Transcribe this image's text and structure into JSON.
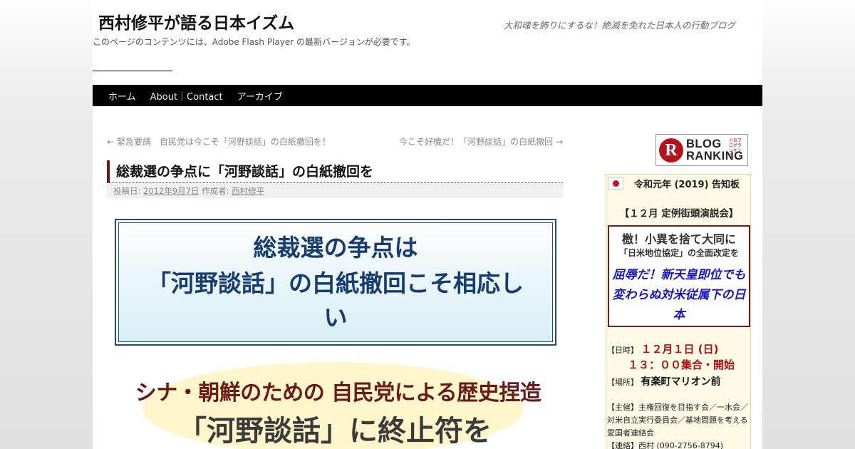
{
  "header": {
    "site_title": "西村修平が語る日本イズム",
    "tagline": "大和魂を飾りにするな！絶滅を免れた日本人の行動ブログ",
    "flash_notice": "このページのコンテンツには、Adobe Flash Player の最新バージョンが必要です。"
  },
  "nav": {
    "items": [
      {
        "label": "ホーム"
      },
      {
        "label": "About｜Contact"
      },
      {
        "label": "アーカイブ"
      }
    ]
  },
  "post_nav": {
    "prev": "← 緊急要請　自民党は今こそ「河野談話」の白紙撤回を！",
    "next": "今こそ好機だ！「河野談話」の白紙撤回 →"
  },
  "post": {
    "title": "総裁選の争点に「河野談話」の白紙撤回を",
    "meta_posted_prefix": "投稿日:",
    "meta_date": "2012年9月7日",
    "meta_author_prefix": "作成者:",
    "meta_author": "西村修平"
  },
  "banner": {
    "line1": "総裁選の争点は",
    "line2": "「河野談話」の白紙撤回こそ相応し",
    "line3": "い"
  },
  "headline": {
    "line1": "シナ・朝鮮のための 自民党による歴史捏造",
    "line2": "「河野談話」に終止符を"
  },
  "sidebar": {
    "ranking": {
      "logo_letter": "R",
      "text1": "BLOG",
      "text2": "RANKING",
      "tag": "人気ブログランキング"
    },
    "notice": {
      "title": "令和元年 (2019) 告知板",
      "subtitle": "【１２月 定例街頭演説会】",
      "red_line1": "檄！小異を捨て大同に",
      "red_line2": "「日米地位協定」の全面改定を",
      "red_line3": "屈辱だ！新天皇即位でも変わらぬ対米従属下の日本",
      "date_label": "【日時】",
      "date_value": "１２月１日 (日)",
      "time_value": "１３：００集合・開始",
      "place_label": "【場所】",
      "place_value": "有楽町マリオン前",
      "organizers": "【主催】主権回復を目指す会／一水会／対米自立実行委員会／基地問題を考える愛国者連絡会",
      "contact": "【連絡】西村 (090-2756-8794)"
    }
  },
  "colors": {
    "nav_bg": "#000000",
    "title_accent": "#6b1717",
    "banner_text": "#163d6f",
    "headline_red": "#6b1a1a",
    "notice_red": "#b01010",
    "notice_blue": "#1616c8"
  }
}
